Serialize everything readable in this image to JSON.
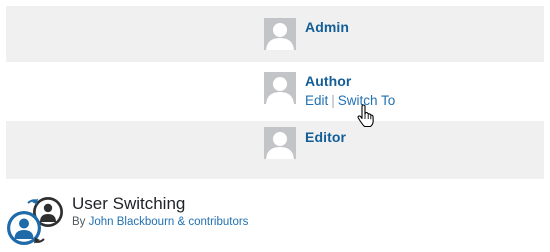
{
  "users": [
    {
      "name": "Admin"
    },
    {
      "name": "Author",
      "actions": {
        "edit": "Edit",
        "separator": "|",
        "switch_to": "Switch To"
      }
    },
    {
      "name": "Editor"
    }
  ],
  "plugin": {
    "title": "User Switching",
    "by_prefix": "By",
    "author_link": "John Blackbourn & contributors"
  },
  "colors": {
    "link": "#2271b1",
    "username": "#135e96",
    "row_stripe": "#f0f0f1"
  },
  "icons": [
    "default-avatar-icon",
    "hand-pointer-cursor-icon",
    "user-switching-logo-icon"
  ]
}
